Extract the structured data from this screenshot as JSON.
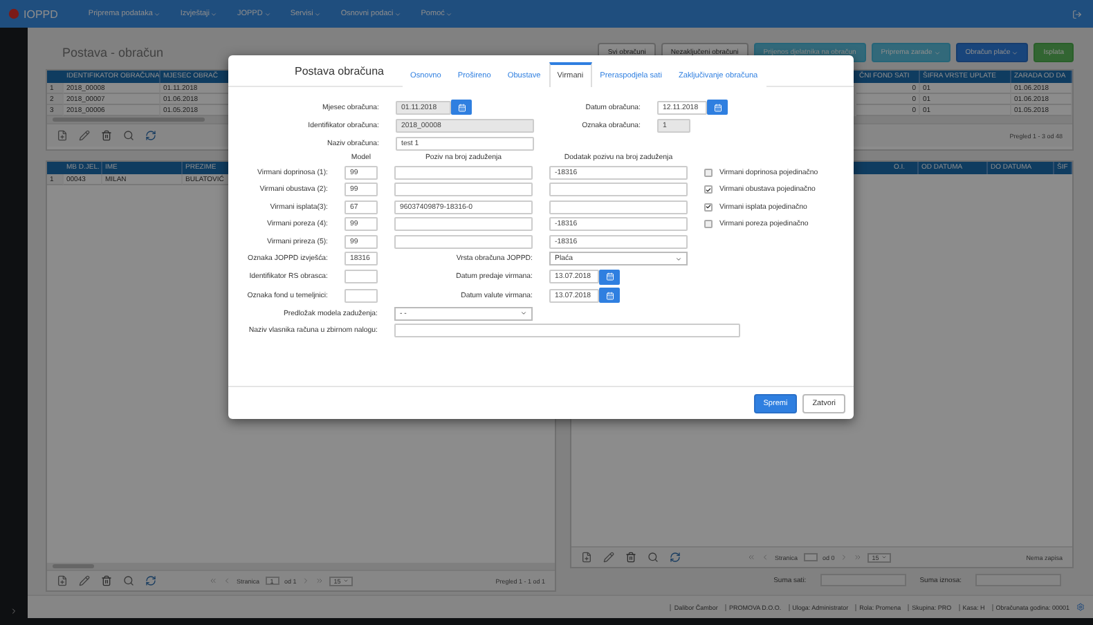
{
  "nav": {
    "logo": "IOPPD",
    "menus": [
      "Priprema podataka",
      "Izvještaji",
      "JOPPD",
      "Servisi",
      "Osnovni podaci",
      "Pomoć"
    ]
  },
  "page_title": "Postava - obračun",
  "actions": [
    {
      "label": "Svi obračuni",
      "kind": "default",
      "dropdown": false
    },
    {
      "label": "Nezaključeni obračuni",
      "kind": "default",
      "dropdown": false
    },
    {
      "label": "Prijenos djelatnika na obračun",
      "kind": "info",
      "dropdown": false
    },
    {
      "label": "Priprema zarade",
      "kind": "info",
      "dropdown": true
    },
    {
      "label": "Obračun plaće",
      "kind": "primary",
      "dropdown": true
    },
    {
      "label": "Isplata",
      "kind": "success",
      "dropdown": false
    }
  ],
  "top_table": {
    "columns": [
      "IDENTIFIKATOR OBRAČUNA",
      "MJESEC OBRAČ",
      "ČNI FOND SATI",
      "ŠIFRA VRSTE UPLATE",
      "ZARADA OD DA"
    ],
    "rows": [
      {
        "number": "1",
        "cells": [
          "2018_00008",
          "01.11.2018",
          "0",
          "01",
          "01.06.2018"
        ]
      },
      {
        "number": "2",
        "cells": [
          "2018_00007",
          "01.06.2018",
          "0",
          "01",
          "01.06.2018"
        ]
      },
      {
        "number": "3",
        "cells": [
          "2018_00006",
          "01.05.2018",
          "0",
          "01",
          "01.05.2018"
        ]
      }
    ],
    "summary": "Pregled 1 - 3 od 48"
  },
  "employees_table": {
    "columns": [
      "MB D.JEL.",
      "IME",
      "PREZIME"
    ],
    "rows": [
      {
        "number": "1",
        "cells": [
          "00043",
          "MILAN",
          "BULATOVIĆ"
        ]
      }
    ],
    "pager": {
      "page_label": "Stranica",
      "page": "1",
      "of": "od 1",
      "size": "15"
    },
    "summary": "Pregled 1 - 1 od 1"
  },
  "hours_table": {
    "columns": [
      "O.I.",
      "OD DATUMA",
      "DO DATUMA",
      "ŠIF"
    ],
    "pager": {
      "page_label": "Stranica",
      "of": "od 0",
      "size": "15"
    },
    "summary": "Nema zapisa"
  },
  "sums": [
    {
      "label": "Suma sati:"
    },
    {
      "label": "Suma iznosa:"
    }
  ],
  "status_bar": [
    "Dalibor Čambor",
    "PROMOVA D.O.O.",
    "Uloga: Administrator",
    "Rola: Promena",
    "Skupina: PRO",
    "Kasa: H",
    "Obračunata godina: 00001"
  ],
  "modal": {
    "title": "Postava obračuna",
    "tabs": [
      {
        "label": "Osnovno",
        "selected": false
      },
      {
        "label": "Prošireno",
        "selected": false
      },
      {
        "label": "Obustave",
        "selected": false
      },
      {
        "label": "Virmani",
        "selected": true
      },
      {
        "label": "Preraspodjela sati",
        "selected": false
      },
      {
        "label": "Zaključivanje obračuna",
        "selected": false
      }
    ],
    "header_rows": [
      {
        "label": "Mjesec obračuna:",
        "value": "01.11.2018",
        "disabled": true,
        "kind": "date",
        "side": {
          "label": "Datum obračuna:",
          "value": "12.11.2018",
          "disabled": false,
          "kind": "date"
        }
      },
      {
        "label": "Identifikator obračuna:",
        "value": "2018_00008",
        "disabled": true,
        "kind": "text",
        "side": {
          "label": "Oznaka obračuna:",
          "value": "1",
          "disabled": true,
          "kind": "short"
        }
      },
      {
        "label": "Naziv obračuna:",
        "value": "test 1",
        "disabled": false,
        "kind": "text"
      }
    ],
    "virman_columns": [
      "Model",
      "Poziv na broj zaduženja",
      "Dodatak pozivu na broj zaduženja"
    ],
    "virmani": [
      {
        "label": "Virmani doprinosa (1):",
        "model": "99",
        "suffix": "-18316",
        "option": {
          "label": "Virmani doprinosa pojedinačno",
          "checked": false
        }
      },
      {
        "label": "Virmani obustava (2):",
        "model": "99",
        "option": {
          "label": "Virmani obustava pojedinačno",
          "checked": true
        }
      },
      {
        "label": "Virmani isplata(3):",
        "model": "67",
        "reference": "96037409879-18316-0",
        "option": {
          "label": "Virmani isplata pojedinačno",
          "checked": true
        }
      },
      {
        "label": "Virmani poreza (4):",
        "model": "99",
        "suffix": "-18316",
        "option": {
          "label": "Virmani poreza pojedinačno",
          "checked": false
        }
      },
      {
        "label": "Virmani prireza (5):",
        "model": "99",
        "suffix": "-18316"
      }
    ],
    "extras": [
      {
        "label": "Oznaka JOPPD izvješća:",
        "value": "18316",
        "side": {
          "label": "Vrsta obračuna JOPPD:",
          "kind": "select",
          "value": "Plaća"
        }
      },
      {
        "label": "Identifikator RS obrasca:",
        "side": {
          "label": "Datum predaje virmana:",
          "kind": "date",
          "value": "13.07.2018"
        }
      },
      {
        "label": "Oznaka fond u temeljnici:",
        "side": {
          "label": "Datum valute virmana:",
          "kind": "date",
          "value": "13.07.2018"
        }
      }
    ],
    "template": {
      "label": "Predložak modela zaduženja:",
      "value": "- -"
    },
    "owner": {
      "label": "Naziv vlasnika računa u zbirnom nalogu:"
    },
    "buttons": [
      {
        "label": "Spremi",
        "kind": "primary"
      },
      {
        "label": "Zatvori",
        "kind": "default"
      }
    ]
  }
}
